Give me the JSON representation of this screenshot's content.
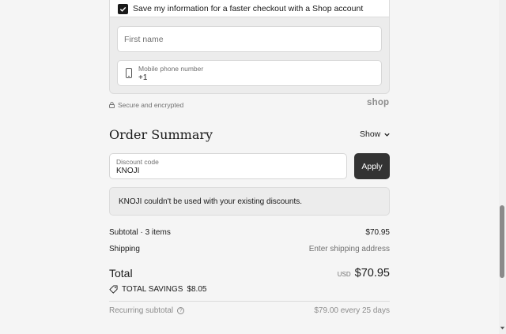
{
  "shop_account": {
    "save_label": "Save my information for a faster checkout with a Shop account",
    "first_name_placeholder": "First name",
    "phone_label": "Mobile phone number",
    "phone_value": "+1",
    "secure_text": "Secure and encrypted",
    "shop_logo": "shop"
  },
  "order_summary": {
    "title": "Order Summary",
    "show_label": "Show",
    "discount_label": "Discount code",
    "discount_value": "KNOJI",
    "apply_label": "Apply",
    "notice": "KNOJI couldn't be used with your existing discounts.",
    "subtotal_label": "Subtotal · 3 items",
    "subtotal_value": "$70.95",
    "shipping_label": "Shipping",
    "shipping_value": "Enter shipping address",
    "total_label": "Total",
    "total_currency": "USD",
    "total_value": "$70.95",
    "savings_label": "TOTAL SAVINGS",
    "savings_value": "$8.05",
    "recurring_label": "Recurring subtotal",
    "recurring_value": "$79.00 every 25 days"
  },
  "icons": {
    "checkbox": "check-icon",
    "phone": "mobile-phone-icon",
    "lock": "lock-icon",
    "chevron": "chevron-down-icon",
    "tag": "tag-icon",
    "help": "help-icon"
  },
  "colors": {
    "background": "#f5f5f5",
    "button": "#333333",
    "muted_text": "#707070",
    "panel": "#ececec"
  }
}
